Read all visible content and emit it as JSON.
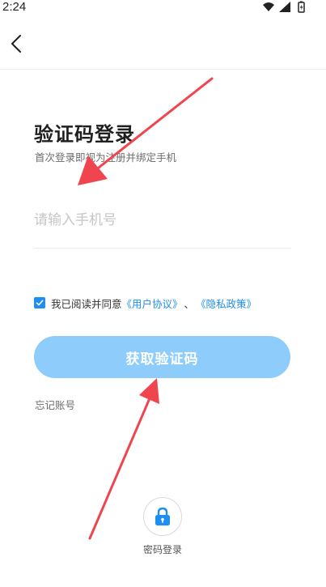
{
  "status_bar": {
    "time": "2:24"
  },
  "nav": {
    "back": "back"
  },
  "header": {
    "title": "验证码登录",
    "subtitle": "首次登录即视为注册并绑定手机"
  },
  "phone_input": {
    "placeholder": "请输入手机号",
    "value": ""
  },
  "agreement": {
    "checked": true,
    "text": "我已阅读并同意",
    "user_agreement": "《用户协议》",
    "separator": "、",
    "privacy_policy": "《隐私政策》"
  },
  "actions": {
    "get_code": "获取验证码",
    "forgot_account": "忘记账号",
    "password_login": "密码登录"
  },
  "colors": {
    "accent": "#1f8ef1",
    "button_disabled": "#8ecdfb",
    "annotation_arrow": "#f0444f"
  },
  "icons": {
    "back": "chevron-left-icon",
    "lock": "lock-icon",
    "wifi": "wifi-icon",
    "signal": "signal-icon",
    "battery": "battery-icon"
  }
}
